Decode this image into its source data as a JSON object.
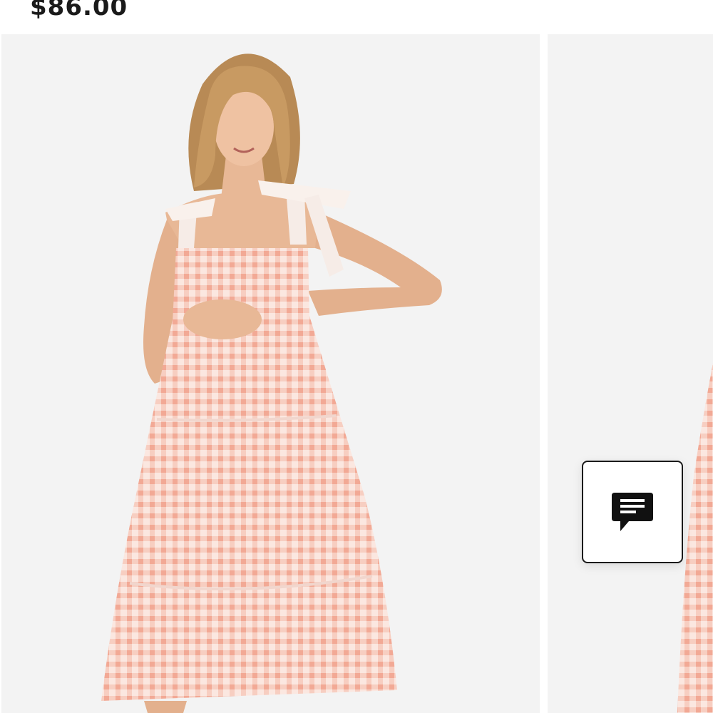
{
  "product": {
    "price": "$86.00"
  },
  "gallery": {
    "images": [
      {
        "name": "model-front-view"
      },
      {
        "name": "model-side-view"
      }
    ]
  },
  "chat": {
    "icon": "chat-icon",
    "color": "#111111"
  },
  "colors": {
    "background": "#ffffff",
    "image_background": "#f3f3f3",
    "dress": "#f8d7cf",
    "gingham": "#f2a995"
  }
}
